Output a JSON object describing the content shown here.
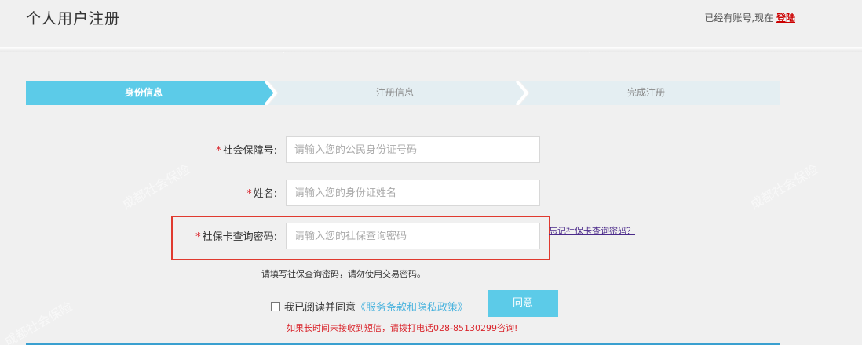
{
  "header": {
    "title": "个人用户注册",
    "account_prefix": "已经有账号,现在",
    "login_label": "登陆"
  },
  "steps": [
    {
      "label": "身份信息",
      "active": true
    },
    {
      "label": "注册信息",
      "active": false
    },
    {
      "label": "完成注册",
      "active": false
    }
  ],
  "form": {
    "ssn": {
      "label": "社会保障号:",
      "placeholder": "请输入您的公民身份证号码"
    },
    "name": {
      "label": "姓名:",
      "placeholder": "请输入您的身份证姓名"
    },
    "password": {
      "label": "社保卡查询密码:",
      "placeholder": "请输入您的社保查询密码"
    },
    "required_mark": "*",
    "forgot_label": "忘记社保卡查询密码？",
    "hint": "请填写社保查询密码，请勿使用交易密码。",
    "agree_text": "我已阅读并同意",
    "policy_label": "《服务条款和隐私政策》",
    "agree_button": "同意",
    "sms_tip": "如果长时间未接收到短信，请拨打电话028-85130299咨询!"
  },
  "watermark_text": "成都社会保险",
  "colors": {
    "step_active": "#5ccbe8",
    "step_inactive": "#e4eef2",
    "required": "#d9232a",
    "highlight": "#e03a2f",
    "policy": "#4ab3de"
  }
}
